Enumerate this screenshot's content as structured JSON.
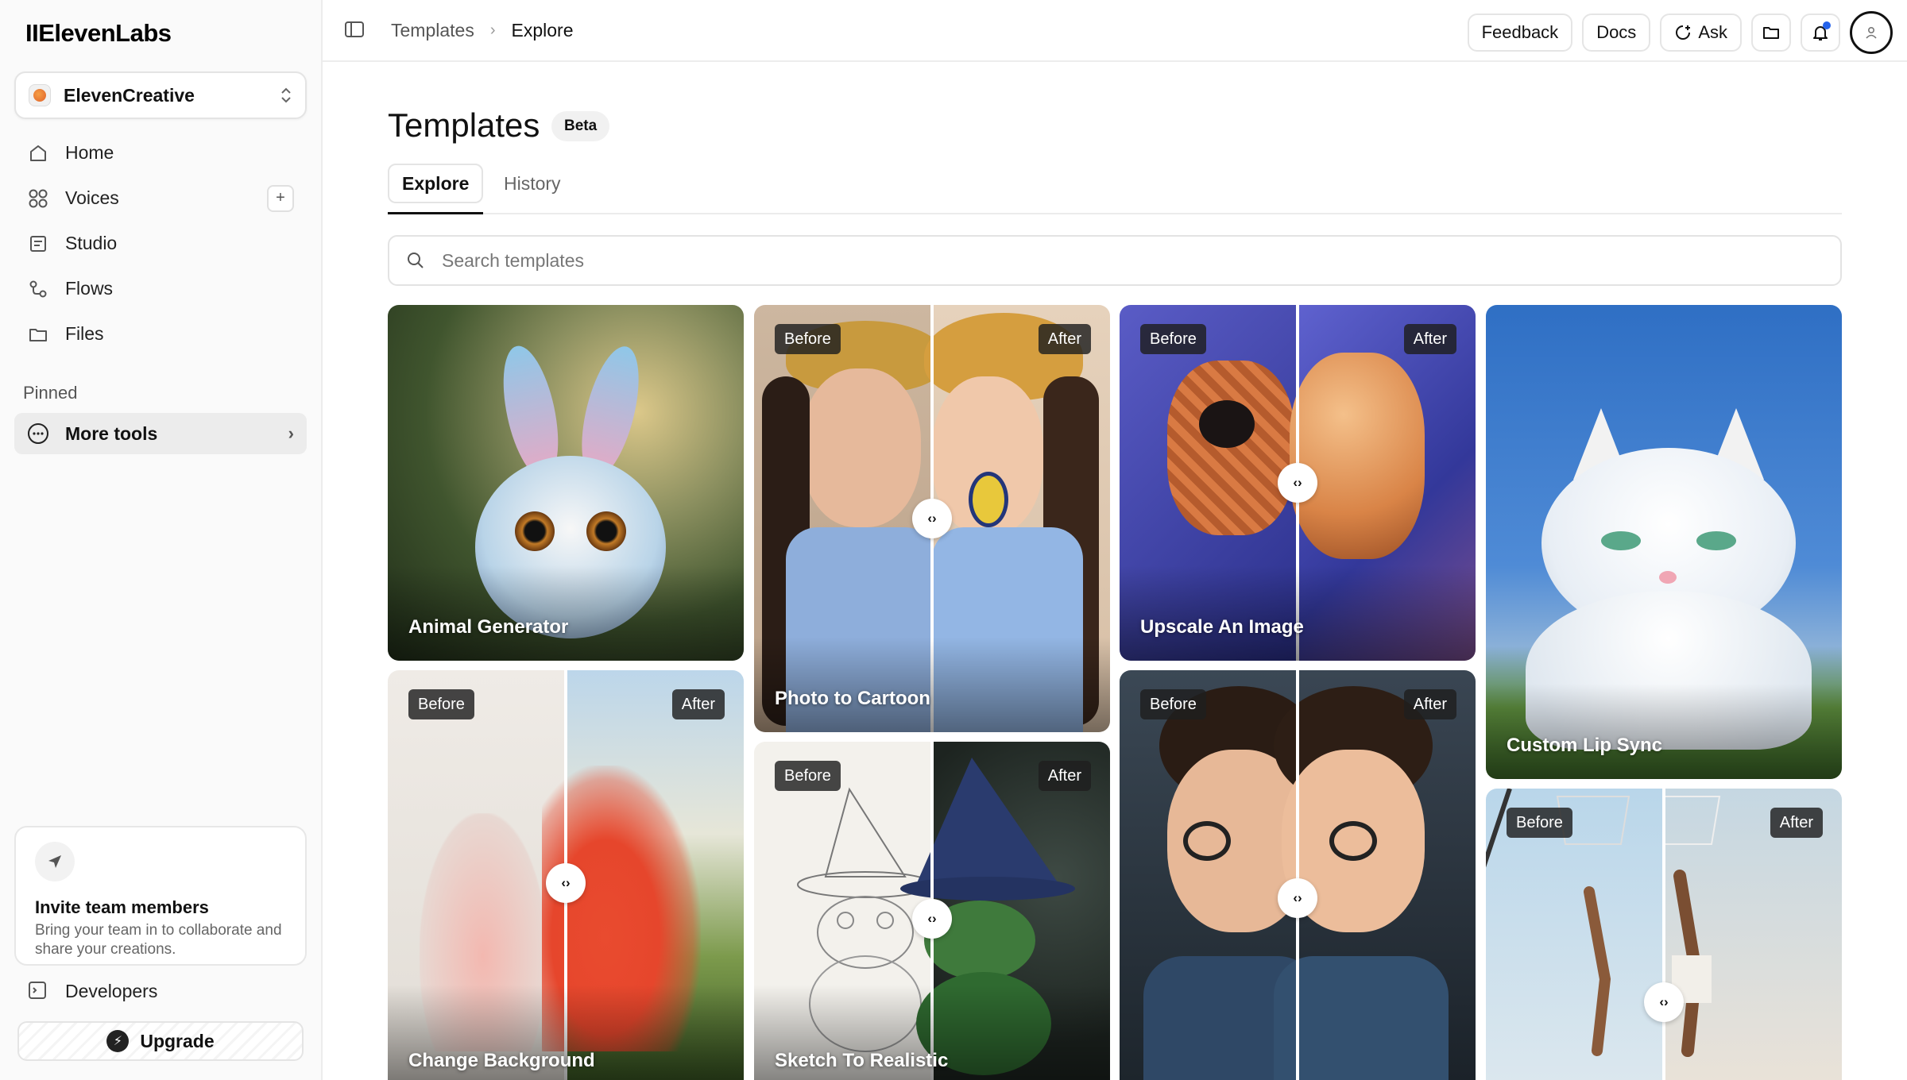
{
  "app": {
    "logo": "IIElevenLabs"
  },
  "workspace": {
    "name": "ElevenCreative"
  },
  "nav": [
    {
      "label": "Home",
      "icon": "home-icon"
    },
    {
      "label": "Voices",
      "icon": "voices-icon"
    },
    {
      "label": "Studio",
      "icon": "studio-icon"
    },
    {
      "label": "Flows",
      "icon": "flows-icon"
    },
    {
      "label": "Files",
      "icon": "folder-icon"
    }
  ],
  "pinned": {
    "label": "Pinned",
    "more_tools": "More tools"
  },
  "invite": {
    "title": "Invite team members",
    "description": "Bring your team in to collaborate and share your creations."
  },
  "footer": {
    "developers": "Developers",
    "upgrade": "Upgrade"
  },
  "breadcrumb": {
    "parent": "Templates",
    "current": "Explore"
  },
  "topbar": {
    "feedback": "Feedback",
    "docs": "Docs",
    "ask": "Ask"
  },
  "page": {
    "title": "Templates",
    "badge": "Beta"
  },
  "tabs": {
    "explore": "Explore",
    "history": "History"
  },
  "search": {
    "placeholder": "Search templates"
  },
  "labels": {
    "before": "Before",
    "after": "After"
  },
  "cards": [
    {
      "title": "Animal Generator"
    },
    {
      "title": "Photo to Cartoon"
    },
    {
      "title": "Upscale An Image"
    },
    {
      "title": "Custom Lip Sync"
    },
    {
      "title": "Change Background"
    },
    {
      "title": "Sketch To Realistic"
    },
    {
      "title": ""
    },
    {
      "title": ""
    }
  ],
  "colors": {
    "accent": "#111111",
    "notification": "#2563eb"
  }
}
